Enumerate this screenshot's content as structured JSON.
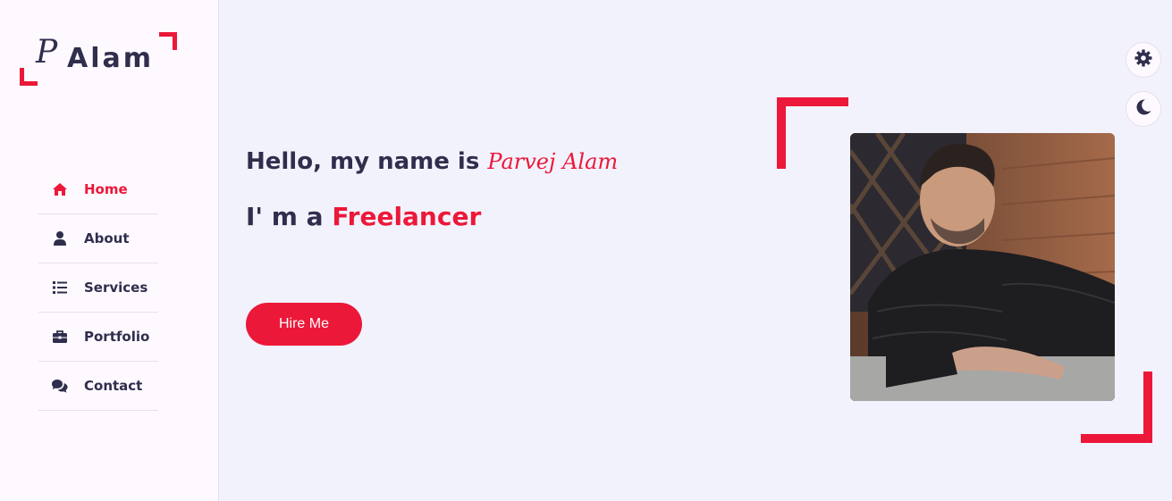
{
  "logo": {
    "initial": "P",
    "text": "Alam"
  },
  "nav": {
    "items": [
      {
        "label": "Home",
        "icon": "home-icon",
        "active": true
      },
      {
        "label": "About",
        "icon": "user-icon",
        "active": false
      },
      {
        "label": "Services",
        "icon": "list-icon",
        "active": false
      },
      {
        "label": "Portfolio",
        "icon": "briefcase-icon",
        "active": false
      },
      {
        "label": "Contact",
        "icon": "comments-icon",
        "active": false
      }
    ]
  },
  "controls": {
    "settings_icon": "gear-icon",
    "theme_icon": "moon-icon"
  },
  "hero": {
    "greeting": "Hello, my name is",
    "name": "Parvej Alam",
    "role_prefix": "I' m a",
    "role": "Freelancer",
    "hire_label": "Hire Me"
  },
  "colors": {
    "accent": "#ec1839",
    "text": "#302e4d",
    "background": "#f2f2fc",
    "sidebar": "#fdf9ff"
  }
}
